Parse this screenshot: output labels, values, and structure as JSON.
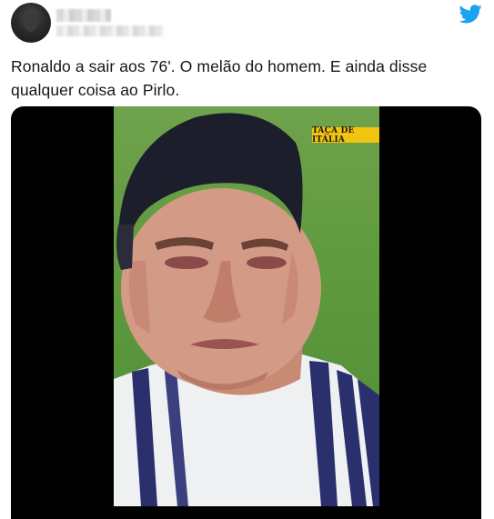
{
  "tweet": {
    "text": "Ronaldo a sair aos 76'. O melão do homem. E ainda disse qualquer coisa ao Pirlo."
  },
  "media": {
    "badge": "TAÇA DE ITÁLIA"
  },
  "colors": {
    "twitter_blue": "#1da1f2",
    "badge_yellow": "#f1c40f",
    "text": "#14171a"
  }
}
